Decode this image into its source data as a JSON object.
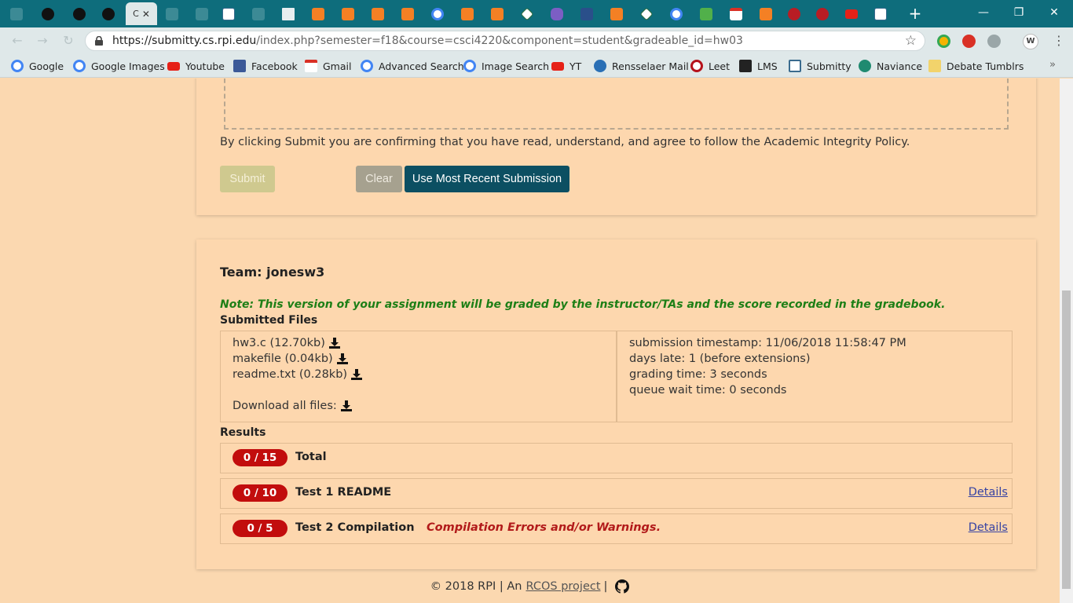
{
  "browser": {
    "url_host": "https://submitty.cs.rpi.edu",
    "url_path": "/index.php?semester=f18&course=csci4220&component=student&gradeable_id=hw03",
    "profile_initial": "W",
    "tab_glyphs": [
      "C",
      "✕"
    ],
    "new_tab": "+",
    "window": {
      "minimize": "—",
      "maximize": "❐",
      "close": "✕"
    },
    "bookmarks": [
      {
        "label": "Google",
        "icon": "google-icon",
        "color": "#4285f4"
      },
      {
        "label": "Google Images",
        "icon": "google-icon",
        "color": "#4285f4"
      },
      {
        "label": "Youtube",
        "icon": "youtube-icon",
        "color": "#e62117"
      },
      {
        "label": "Facebook",
        "icon": "facebook-icon",
        "color": "#3b5998"
      },
      {
        "label": "Gmail",
        "icon": "gmail-icon",
        "color": "#d93025"
      },
      {
        "label": "Advanced Search",
        "icon": "google-icon",
        "color": "#4285f4"
      },
      {
        "label": "Image Search",
        "icon": "google-icon",
        "color": "#4285f4"
      },
      {
        "label": "YT",
        "icon": "youtube-icon",
        "color": "#e62117"
      },
      {
        "label": "Rensselaer Mail",
        "icon": "mail-icon",
        "color": "#2a6fb5"
      },
      {
        "label": "Leet",
        "icon": "leet-icon",
        "color": "#b5121b"
      },
      {
        "label": "LMS",
        "icon": "blackboard-icon",
        "color": "#222222"
      },
      {
        "label": "Submitty",
        "icon": "submitty-icon",
        "color": "#3a6b8e"
      },
      {
        "label": "Naviance",
        "icon": "naviance-icon",
        "color": "#1f8a70"
      },
      {
        "label": "Debate Tumblrs",
        "icon": "folder-icon",
        "color": "#f2d36b"
      }
    ]
  },
  "upload": {
    "policy_text": "By clicking Submit you are confirming that you have read, understand, and agree to follow the Academic Integrity Policy.",
    "submit_label": "Submit",
    "clear_label": "Clear",
    "recent_label": "Use Most Recent Submission"
  },
  "results": {
    "team": "Team: jonesw3",
    "note": "Note: This version of your assignment will be graded by the instructor/TAs and the score recorded in the gradebook.",
    "submitted_files_heading": "Submitted Files",
    "files": [
      "hw3.c (12.70kb)",
      "makefile (0.04kb)",
      "readme.txt (0.28kb)"
    ],
    "download_all": "Download all files:",
    "info": [
      "submission timestamp: 11/06/2018 11:58:47 PM",
      "days late: 1 (before extensions)",
      "grading time: 3 seconds",
      "queue wait time: 0 seconds"
    ],
    "results_heading": "Results",
    "rows": [
      {
        "score": "0 / 15",
        "title": "Total",
        "message": "",
        "details": ""
      },
      {
        "score": "0 / 10",
        "title": "Test 1 README",
        "message": "",
        "details": "Details"
      },
      {
        "score": "0 / 5",
        "title": "Test 2 Compilation",
        "message": "Compilation Errors and/or Warnings.",
        "details": "Details"
      }
    ]
  },
  "footer": {
    "prefix": "© 2018 RPI | An",
    "link": "RCOS project",
    "suffix": "|"
  },
  "colors": {
    "page_bg": "#fbd8b0",
    "chrome": "#0e6d7c",
    "score_badge": "#c20d0d",
    "note_green": "#1d7f16",
    "primary_button": "#0c4f62"
  }
}
